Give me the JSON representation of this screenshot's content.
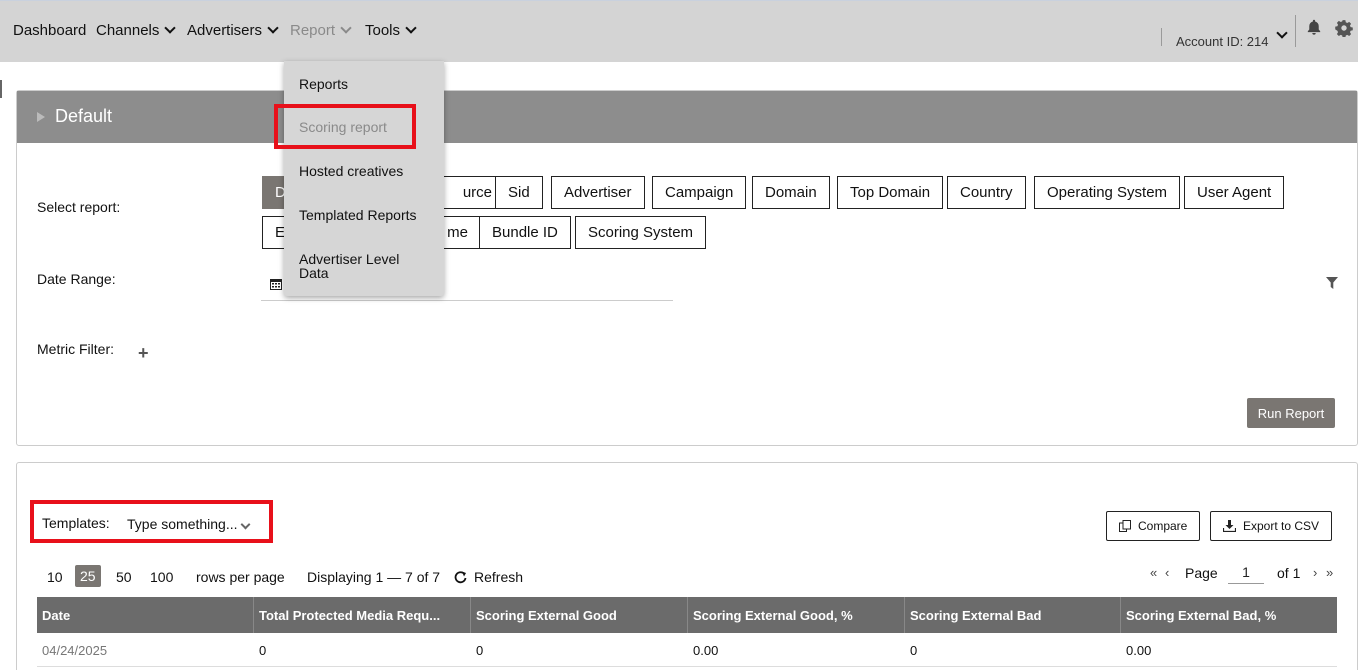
{
  "nav": {
    "items": [
      {
        "label": "Dashboard",
        "chevron": false
      },
      {
        "label": "Channels",
        "chevron": true
      },
      {
        "label": "Advertisers",
        "chevron": true
      },
      {
        "label": "Report",
        "chevron": true
      },
      {
        "label": "Tools",
        "chevron": true
      }
    ],
    "account": "Account ID: 214"
  },
  "report_menu": {
    "items": [
      "Reports",
      "Scoring report",
      "Hosted creatives",
      "Templated Reports",
      "Advertiser Level Data"
    ],
    "highlighted": "Scoring report"
  },
  "filters": {
    "title": "Default",
    "select_report_label": "Select report:",
    "report_buttons_row1": [
      "D",
      "urce",
      "Sid",
      "Advertiser",
      "Campaign",
      "Domain",
      "Top Domain",
      "Country",
      "Operating System",
      "User Agent"
    ],
    "report_buttons_row2": [
      "E",
      "me",
      "Bundle ID",
      "Scoring System"
    ],
    "date_range_label": "Date Range:",
    "metric_filter_label": "Metric Filter:",
    "run_button": "Run Report"
  },
  "results": {
    "templates_label": "Templates:",
    "templates_placeholder": "Type something...",
    "compare_button": "Compare",
    "export_button": "Export to CSV",
    "page_sizes": [
      "10",
      "25",
      "50",
      "100"
    ],
    "selected_page_size": "25",
    "rows_per_page": "rows per page",
    "displaying": "Displaying 1 — 7 of 7",
    "refresh": "Refresh",
    "page_label": "Page",
    "page_value": "1",
    "of_pages": "of 1",
    "columns": [
      "Date",
      "Total Protected Media Requ...",
      "Scoring External Good",
      "Scoring External Good, %",
      "Scoring External Bad",
      "Scoring External Bad, %"
    ],
    "rows": [
      [
        "04/24/2025",
        "0",
        "0",
        "0.00",
        "0",
        "0.00"
      ]
    ]
  },
  "colors": {
    "highlight": "#e8101a",
    "nav_bg": "#d4d4d4",
    "header_bg": "#8d8d8d",
    "table_head": "#6b6b6b"
  }
}
